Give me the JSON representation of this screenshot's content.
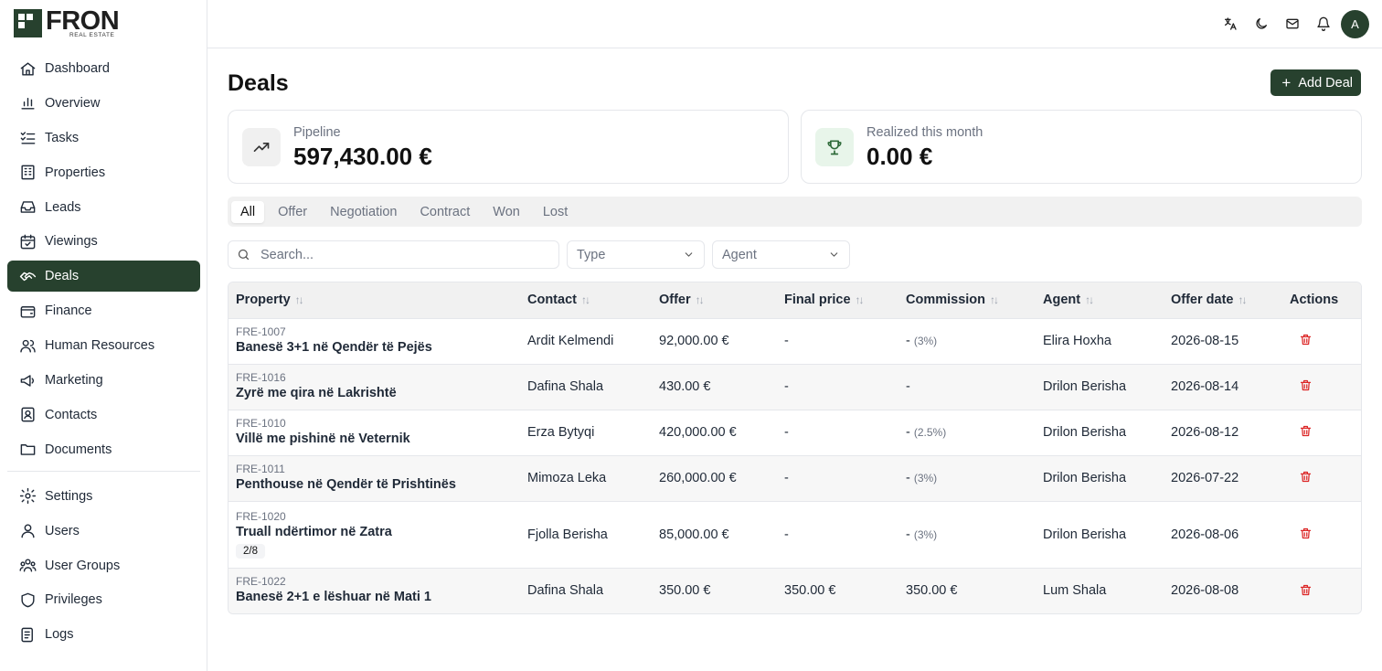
{
  "brand": {
    "name": "FRON",
    "sub": "REAL ESTATE"
  },
  "sidebar": {
    "items": [
      {
        "label": "Dashboard",
        "icon": "home-icon"
      },
      {
        "label": "Overview",
        "icon": "bar-chart-icon"
      },
      {
        "label": "Tasks",
        "icon": "list-checks-icon"
      },
      {
        "label": "Properties",
        "icon": "building-icon"
      },
      {
        "label": "Leads",
        "icon": "inbox-icon"
      },
      {
        "label": "Viewings",
        "icon": "calendar-check-icon"
      },
      {
        "label": "Deals",
        "icon": "handshake-icon"
      },
      {
        "label": "Finance",
        "icon": "wallet-icon"
      },
      {
        "label": "Human Resources",
        "icon": "users-icon"
      },
      {
        "label": "Marketing",
        "icon": "megaphone-icon"
      },
      {
        "label": "Contacts",
        "icon": "contacts-icon"
      },
      {
        "label": "Documents",
        "icon": "folder-icon"
      },
      {
        "label": "Settings",
        "icon": "gear-icon"
      },
      {
        "label": "Users",
        "icon": "user-icon"
      },
      {
        "label": "User Groups",
        "icon": "user-group-icon"
      },
      {
        "label": "Privileges",
        "icon": "shield-icon"
      },
      {
        "label": "Logs",
        "icon": "log-icon"
      }
    ],
    "active": "Deals"
  },
  "header": {
    "avatar_initial": "A"
  },
  "page": {
    "title": "Deals",
    "add_label": "Add Deal"
  },
  "stats": {
    "pipeline": {
      "label": "Pipeline",
      "value": "597,430.00 €"
    },
    "realized": {
      "label": "Realized this month",
      "value": "0.00 €"
    }
  },
  "tabs": [
    "All",
    "Offer",
    "Negotiation",
    "Contract",
    "Won",
    "Lost"
  ],
  "filters": {
    "search_placeholder": "Search...",
    "type_label": "Type",
    "agent_label": "Agent"
  },
  "table": {
    "headers": [
      "Property",
      "Contact",
      "Offer",
      "Final price",
      "Commission",
      "Agent",
      "Offer date",
      "Actions"
    ],
    "rows": [
      {
        "code": "FRE-1007",
        "name": "Banesë 3+1 në Qendër të Pejës",
        "badge": "",
        "contact": "Ardit Kelmendi",
        "offer": "92,000.00 €",
        "final": "-",
        "commission": "-",
        "pct": "(3%)",
        "agent": "Elira Hoxha",
        "date": "2026-08-15"
      },
      {
        "code": "FRE-1016",
        "name": "Zyrë me qira në Lakrishtë",
        "badge": "",
        "contact": "Dafina Shala",
        "offer": "430.00 €",
        "final": "-",
        "commission": "-",
        "pct": "",
        "agent": "Drilon Berisha",
        "date": "2026-08-14"
      },
      {
        "code": "FRE-1010",
        "name": "Villë me pishinë në Veternik",
        "badge": "",
        "contact": "Erza Bytyqi",
        "offer": "420,000.00 €",
        "final": "-",
        "commission": "-",
        "pct": "(2.5%)",
        "agent": "Drilon Berisha",
        "date": "2026-08-12"
      },
      {
        "code": "FRE-1011",
        "name": "Penthouse në Qendër të Prishtinës",
        "badge": "",
        "contact": "Mimoza Leka",
        "offer": "260,000.00 €",
        "final": "-",
        "commission": "-",
        "pct": "(3%)",
        "agent": "Drilon Berisha",
        "date": "2026-07-22"
      },
      {
        "code": "FRE-1020",
        "name": "Truall ndërtimor në Zatra",
        "badge": "2/8",
        "contact": "Fjolla Berisha",
        "offer": "85,000.00 €",
        "final": "-",
        "commission": "-",
        "pct": "(3%)",
        "agent": "Drilon Berisha",
        "date": "2026-08-06"
      },
      {
        "code": "FRE-1022",
        "name": "Banesë 2+1 e lëshuar në Mati 1",
        "badge": "",
        "contact": "Dafina Shala",
        "offer": "350.00 €",
        "final": "350.00 €",
        "commission": "350.00 €",
        "pct": "",
        "agent": "Lum Shala",
        "date": "2026-08-08"
      }
    ]
  },
  "colors": {
    "brand": "#27412e",
    "danger": "#dc2626",
    "muted": "#6b7280"
  }
}
